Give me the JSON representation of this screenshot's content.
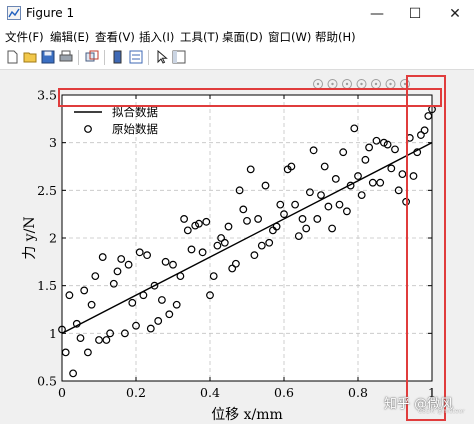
{
  "window": {
    "title": "Figure 1",
    "controls": {
      "minimize": "—",
      "maximize": "☐",
      "close": "✕"
    }
  },
  "menu": [
    {
      "name": "file",
      "label": "文件(F)"
    },
    {
      "name": "edit",
      "label": "编辑(E)"
    },
    {
      "name": "view",
      "label": "查看(V)"
    },
    {
      "name": "insert",
      "label": "插入(I)"
    },
    {
      "name": "tools",
      "label": "工具(T)"
    },
    {
      "name": "desktop",
      "label": "桌面(D)"
    },
    {
      "name": "window",
      "label": "窗口(W)"
    },
    {
      "name": "help",
      "label": "帮助(H)"
    }
  ],
  "toolbar": [
    "new-icon",
    "open-icon",
    "save-icon",
    "print-icon",
    "link-icon",
    "colorbar-icon",
    "legend-icon",
    "pointer-icon",
    "propertyeditor-icon"
  ],
  "axes_toolbar": [
    "export-icon",
    "brush-icon",
    "datatip-icon",
    "pan-icon",
    "zoom-in-icon",
    "zoom-out-icon",
    "home-icon"
  ],
  "watermark": {
    "text": "知乎 @微风",
    "sub": "CSDN @meteor"
  },
  "chart_data": {
    "type": "scatter",
    "xlabel": "位移 x/mm",
    "ylabel": "力 y/N",
    "xlim": [
      0,
      1
    ],
    "ylim": [
      0.5,
      3.5
    ],
    "xticks": [
      "0",
      "0.2",
      "0.4",
      "0.6",
      "0.8",
      "1"
    ],
    "yticks": [
      "0.5",
      "1",
      "1.5",
      "2",
      "2.5",
      "3",
      "3.5"
    ],
    "grid": true,
    "legend_position": "top-left",
    "series": [
      {
        "name": "拟合数据",
        "kind": "line",
        "x": [
          0,
          1
        ],
        "y": [
          1.0,
          3.0
        ]
      },
      {
        "name": "原始数据",
        "kind": "markers",
        "x": [
          0,
          0.01,
          0.02,
          0.03,
          0.04,
          0.05,
          0.06,
          0.07,
          0.08,
          0.09,
          0.1,
          0.11,
          0.12,
          0.13,
          0.14,
          0.15,
          0.16,
          0.17,
          0.18,
          0.19,
          0.2,
          0.21,
          0.22,
          0.23,
          0.24,
          0.25,
          0.26,
          0.27,
          0.28,
          0.29,
          0.3,
          0.31,
          0.32,
          0.33,
          0.34,
          0.35,
          0.36,
          0.37,
          0.38,
          0.39,
          0.4,
          0.41,
          0.42,
          0.43,
          0.44,
          0.45,
          0.46,
          0.47,
          0.48,
          0.49,
          0.5,
          0.51,
          0.52,
          0.53,
          0.54,
          0.55,
          0.56,
          0.57,
          0.58,
          0.59,
          0.6,
          0.61,
          0.62,
          0.63,
          0.64,
          0.65,
          0.66,
          0.67,
          0.68,
          0.69,
          0.7,
          0.71,
          0.72,
          0.73,
          0.74,
          0.75,
          0.76,
          0.77,
          0.78,
          0.79,
          0.8,
          0.81,
          0.82,
          0.83,
          0.84,
          0.85,
          0.86,
          0.87,
          0.88,
          0.89,
          0.9,
          0.91,
          0.92,
          0.93,
          0.94,
          0.95,
          0.96,
          0.97,
          0.98,
          0.99,
          1.0
        ],
        "y": [
          1.04,
          0.8,
          1.4,
          0.58,
          1.1,
          0.95,
          1.45,
          0.8,
          1.3,
          1.6,
          0.93,
          1.8,
          0.93,
          1.0,
          1.52,
          1.65,
          1.78,
          1.0,
          1.72,
          1.32,
          1.08,
          1.85,
          1.4,
          1.82,
          1.05,
          1.5,
          1.13,
          1.35,
          1.75,
          1.2,
          1.72,
          1.3,
          1.6,
          2.2,
          2.08,
          1.88,
          2.13,
          2.15,
          1.85,
          2.17,
          1.4,
          1.6,
          1.92,
          2.0,
          1.95,
          2.12,
          1.68,
          1.73,
          2.5,
          2.3,
          2.18,
          2.72,
          1.82,
          2.2,
          1.92,
          2.55,
          1.95,
          2.08,
          2.12,
          2.35,
          2.25,
          2.72,
          2.75,
          2.35,
          2.02,
          2.2,
          2.1,
          2.48,
          2.92,
          2.2,
          2.45,
          2.75,
          2.33,
          2.1,
          2.62,
          2.35,
          2.9,
          2.28,
          2.55,
          3.15,
          2.65,
          2.45,
          2.82,
          2.95,
          2.58,
          3.02,
          2.58,
          3.0,
          2.98,
          2.73,
          2.93,
          2.5,
          2.67,
          2.38,
          3.05,
          2.65,
          2.9,
          3.08,
          3.13,
          3.28,
          3.35
        ]
      }
    ]
  }
}
